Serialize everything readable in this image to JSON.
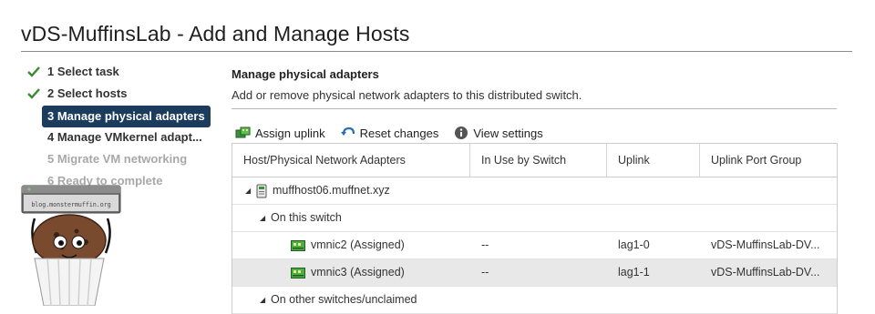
{
  "wizard": {
    "title": "vDS-MuffinsLab - Add and Manage Hosts"
  },
  "steps": [
    {
      "label": "1 Select task",
      "done": true
    },
    {
      "label": "2 Select hosts",
      "done": true
    },
    {
      "label": "3 Manage physical adapters",
      "active": true
    },
    {
      "label": "4 Manage VMkernel adapt..."
    },
    {
      "label": "5 Migrate VM networking",
      "disabled": true
    },
    {
      "label": "6 Ready to complete",
      "disabled": true
    }
  ],
  "mascot": {
    "banner_text": "blog.monstermuffin.org"
  },
  "section": {
    "heading": "Manage physical adapters",
    "description": "Add or remove physical network adapters to this distributed switch."
  },
  "toolbar": {
    "assign_uplink": "Assign uplink",
    "reset_changes": "Reset changes",
    "view_settings": "View settings"
  },
  "grid": {
    "columns": [
      "Host/Physical Network Adapters",
      "In Use by Switch",
      "Uplink",
      "Uplink Port Group"
    ],
    "rows": {
      "host": "muffhost06.muffnet.xyz",
      "on_switch": "On this switch",
      "nic1": {
        "name": "vmnic2 (Assigned)",
        "switch": "--",
        "uplink": "lag1-0",
        "portgroup": "vDS-MuffinsLab-DV..."
      },
      "nic2": {
        "name": "vmnic3 (Assigned)",
        "switch": "--",
        "uplink": "lag1-1",
        "portgroup": "vDS-MuffinsLab-DV..."
      },
      "other": "On other switches/unclaimed"
    }
  },
  "colors": {
    "active_step_bg": "#1b3c5c",
    "check_green": "#3a8a2e",
    "selected_row": "#e8e8e8"
  }
}
